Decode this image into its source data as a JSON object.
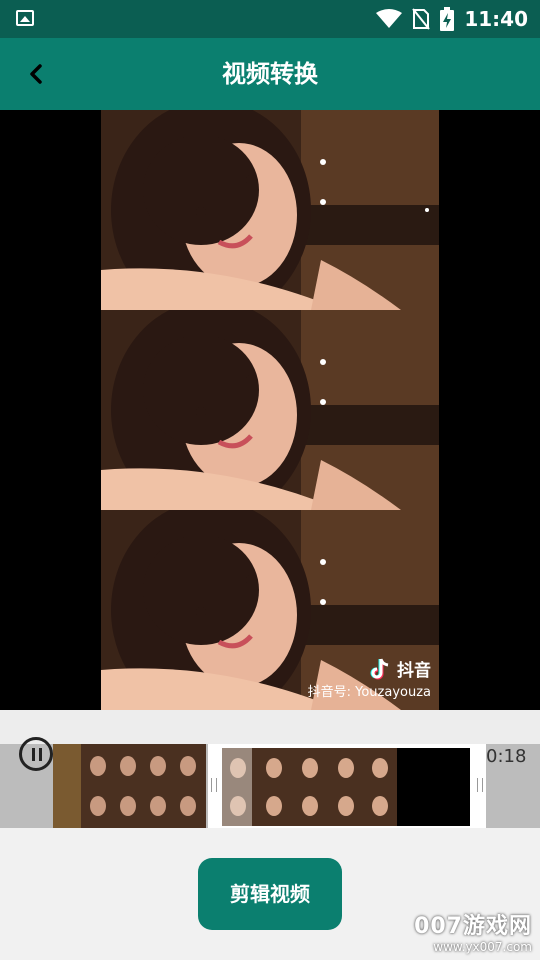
{
  "status_bar": {
    "time": "11:40"
  },
  "header": {
    "title": "视频转换"
  },
  "video": {
    "watermark_app": "抖音",
    "watermark_id": "抖音号: Youzayouza"
  },
  "timeline": {
    "end_time": "0:18"
  },
  "actions": {
    "cut_button": "剪辑视频"
  },
  "site_watermark": {
    "name": "007游戏网",
    "url": "www.yx007.com"
  },
  "colors": {
    "primary": "#0b7f6f",
    "status_bar": "#0b5e52"
  }
}
